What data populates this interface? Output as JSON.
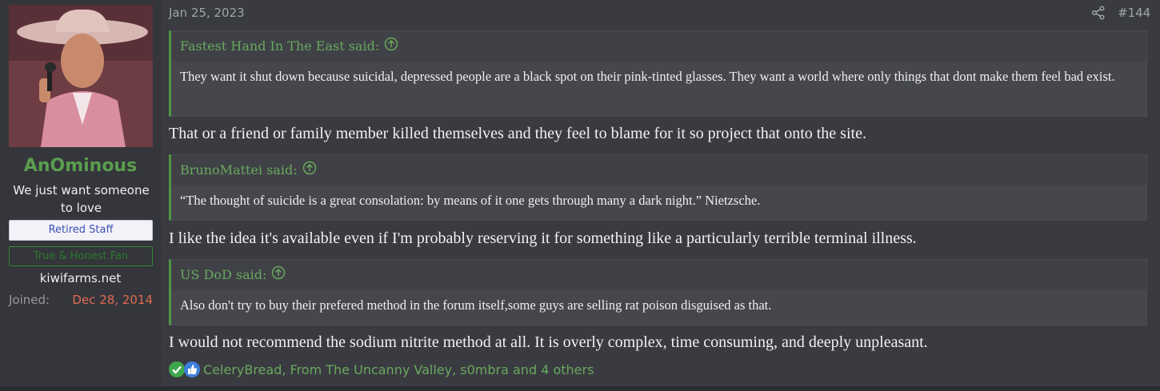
{
  "user": {
    "name": "AnOminous",
    "title": "We just want someone to love",
    "banner_primary": "Retired Staff",
    "banner_secondary": "True & Honest Fan",
    "site": "kiwifarms.net",
    "joined_label": "Joined:",
    "joined_value": "Dec 28, 2014"
  },
  "post": {
    "date": "Jan 25, 2023",
    "number": "#144",
    "quotes": [
      {
        "author": "Fastest Hand In The East said:",
        "body": "They want it shut down because suicidal, depressed people are a black spot on their pink-tinted glasses. They want a world where only things that dont make them feel bad exist."
      },
      {
        "author": "BrunoMattei said:",
        "body": "“The thought of suicide is a great consolation: by means of it one gets through many a dark night.” Nietzsche."
      },
      {
        "author": "US DoD said:",
        "body": "Also don't try to buy their prefered method in the forum itself,some guys are selling rat poison disguised as that."
      }
    ],
    "replies": [
      "That or a friend or family member killed themselves and they feel to blame for it so project that onto the site.",
      "I like the idea it's available even if I'm probably reserving it for something like a particularly terrible terminal illness.",
      "I would not recommend the sodium nitrite method at all. It is overly complex, time consuming, and deeply unpleasant."
    ],
    "reactions_text": "CeleryBread, From The Uncanny Valley, s0mbra and 4 others"
  },
  "icons": {
    "share": "share-icon",
    "quote_up": "arrow-up-circle-icon",
    "reaction_1": "checkmark-reaction-icon",
    "reaction_2": "thumbs-up-reaction-icon"
  },
  "colors": {
    "accent_green": "#6aa85e",
    "username_green": "#5a9e4e",
    "joined_date": "#e06a50"
  }
}
